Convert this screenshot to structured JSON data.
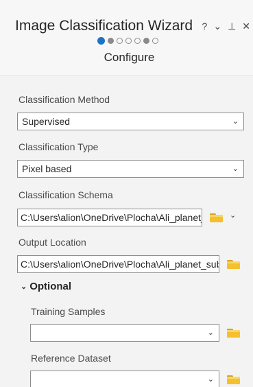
{
  "header": {
    "title": "Image Classification Wizard",
    "help_icon": "?",
    "menu_icon": "⌄",
    "pin_icon": "⊥",
    "close_icon": "✕",
    "step_name": "Configure",
    "steps_total": 7,
    "current_step": 1
  },
  "fields": {
    "classification_method": {
      "label": "Classification Method",
      "value": "Supervised"
    },
    "classification_type": {
      "label": "Classification Type",
      "value": "Pixel based"
    },
    "classification_schema": {
      "label": "Classification Schema",
      "value": "C:\\Users\\alion\\OneDrive\\Plocha\\Ali_planet_sub.ecs"
    },
    "output_location": {
      "label": "Output Location",
      "value": "C:\\Users\\alion\\OneDrive\\Plocha\\Ali_planet_sub"
    }
  },
  "optional": {
    "label": "Optional",
    "training_samples": {
      "label": "Training Samples",
      "value": ""
    },
    "reference_dataset": {
      "label": "Reference Dataset",
      "value": ""
    }
  },
  "colors": {
    "accent": "#1a73c9",
    "folder": "#f4c02e",
    "panel_bg": "#f3f3f3"
  }
}
